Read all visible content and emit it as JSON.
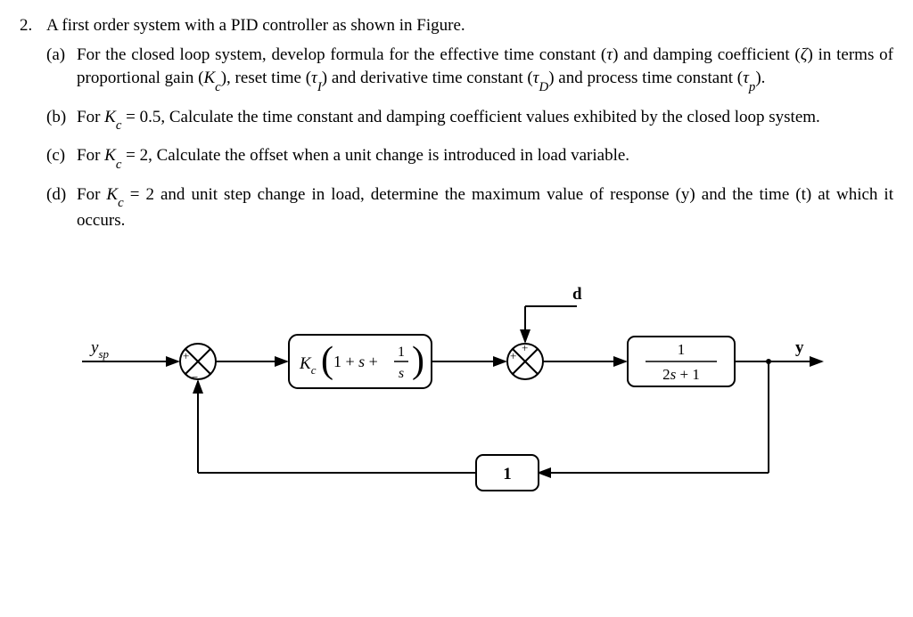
{
  "question": {
    "number": "2.",
    "stem": "A first order system with a PID controller as shown in Figure."
  },
  "parts": {
    "a": {
      "label": "(a)",
      "t1": "For the closed loop system, develop formula for the effective time constant (",
      "tau": "τ",
      "t2": ") and damping coefficient (",
      "zeta": "ζ",
      "t3": ") in terms of proportional gain (",
      "Kc_K": "K",
      "Kc_c": "c",
      "t4": "), reset time (",
      "tI_t": "τ",
      "tI_I": "I",
      "t5": ") and derivative time constant (",
      "tD_t": "τ",
      "tD_D": "D",
      "t6": ") and process time constant (",
      "tp_t": "τ",
      "tp_p": "p",
      "t7": ")."
    },
    "b": {
      "label": "(b)",
      "t1": "For ",
      "K": "K",
      "c": "c",
      "eq": " = 0.5, Calculate the time constant and damping coefficient values exhibited by the closed loop system."
    },
    "c": {
      "label": "(c)",
      "t1": "For ",
      "K": "K",
      "c": "c",
      "eq": " = 2, Calculate the offset when a unit change is introduced in load variable."
    },
    "d": {
      "label": "(d)",
      "t1": "For ",
      "K": "K",
      "c": "c",
      "eq": " = 2 and unit step change in load, determine the maximum value of response (y) and the time (t) at which it occurs."
    }
  },
  "figure": {
    "ysp_y": "y",
    "ysp_sp": "sp",
    "d": "d",
    "y": "y",
    "Kc_K": "K",
    "Kc_c": "c",
    "pid_open": "(",
    "pid_mid": "1 + ",
    "pid_s": "s",
    "pid_plus": " + ",
    "pid_fr_num": "1",
    "pid_fr_den": "s",
    "pid_close": ")",
    "proc_num": "1",
    "proc_den_a": "2",
    "proc_den_s": "s",
    "proc_den_b": " + 1",
    "fb": "1",
    "sum_plus": "+",
    "sum_minus": "−"
  }
}
